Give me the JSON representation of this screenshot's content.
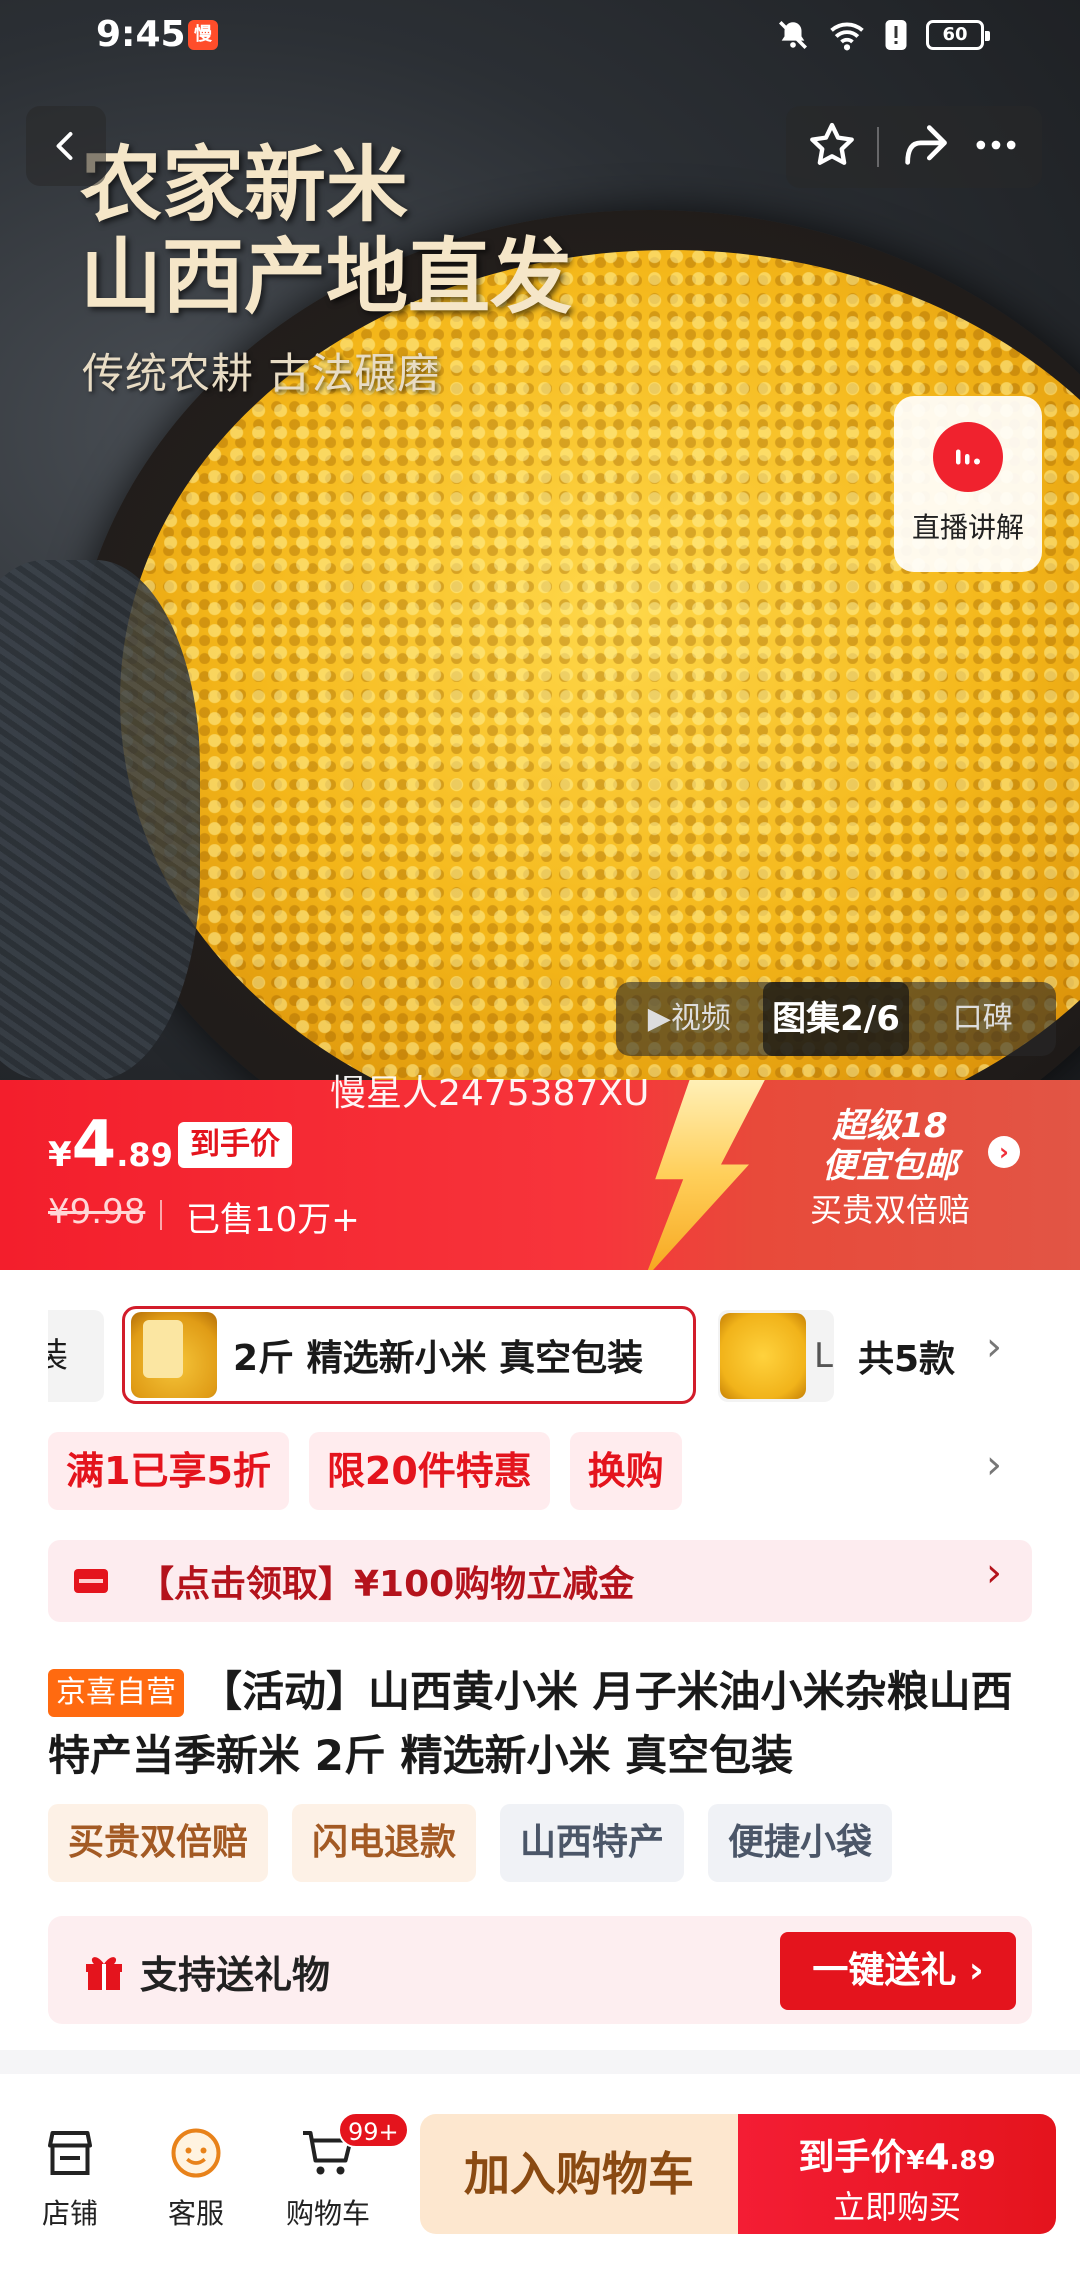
{
  "status_bar": {
    "time": "9:45",
    "app_badge": "慢",
    "battery": "60"
  },
  "hero": {
    "title_line1": "农家新米",
    "title_line2": "山西产地直发",
    "subtitle": "传统农耕 古法碾磨",
    "live_label": "直播讲解",
    "media_tabs": [
      {
        "label": "▶视频",
        "active": false
      },
      {
        "label": "图集2/6",
        "active": true
      },
      {
        "label": "口碑",
        "active": false
      }
    ]
  },
  "price": {
    "watermark": "慢星人2475387XU",
    "symbol": "¥",
    "integer": "4",
    "decimal": ".89",
    "tag": "到手价",
    "original": "¥9.98",
    "sold": "已售10万+",
    "promo_line1": "超级18",
    "promo_line2": "便宜包邮",
    "promo_line3": "买贵双倍赔"
  },
  "variants": {
    "partial_label": "装",
    "selected_label": "2斤 精选新小米 真空包装",
    "next_partial": "L",
    "count": "共5款"
  },
  "promo_tags": [
    "满1已享5折",
    "限20件特惠",
    "换购"
  ],
  "coupon": {
    "text": "【点击领取】¥100购物立减金"
  },
  "product": {
    "badge": "京喜自营",
    "title": "【活动】山西黄小米 月子米油小米杂粮山西特产当季新米 2斤 精选新小米 真空包装"
  },
  "feature_tags": [
    {
      "label": "买贵双倍赔",
      "style": "warm"
    },
    {
      "label": "闪电退款",
      "style": "warm"
    },
    {
      "label": "山西特产",
      "style": "cool"
    },
    {
      "label": "便捷小袋",
      "style": "cool"
    }
  ],
  "gift": {
    "text": "支持送礼物",
    "button": "一键送礼 ›"
  },
  "bottom_bar": {
    "shop": "店铺",
    "service": "客服",
    "cart": "购物车",
    "cart_badge": "99+",
    "add_cart": "加入购物车",
    "buy_label": "到手价",
    "buy_symbol": "¥",
    "buy_int": "4",
    "buy_dec": ".89",
    "buy_now": "立即购买"
  },
  "colors": {
    "accent_red": "#e4141d",
    "orange_badge": "#ff6a10"
  }
}
